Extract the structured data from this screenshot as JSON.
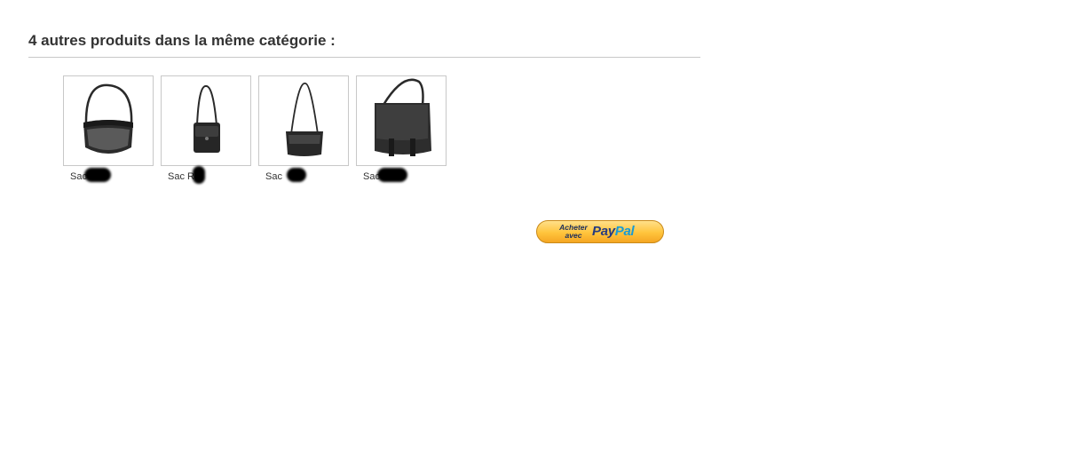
{
  "section": {
    "title": "4 autres produits dans la même catégorie :"
  },
  "products": [
    {
      "name": "Sac",
      "image_icon": "shoulder-bag-flap-icon"
    },
    {
      "name": "Sac R",
      "image_icon": "small-crossbody-bag-icon"
    },
    {
      "name": "Sac",
      "image_icon": "crossbody-bag-icon"
    },
    {
      "name": "Sac",
      "image_icon": "messenger-bag-icon"
    }
  ],
  "paypal_button": {
    "line1": "Acheter",
    "line2": "avec",
    "logo_pay": "Pay",
    "logo_pal": "Pal",
    "colors": {
      "gold": "#ffc43c",
      "navy": "#253b80",
      "cyan": "#179bd7"
    }
  }
}
